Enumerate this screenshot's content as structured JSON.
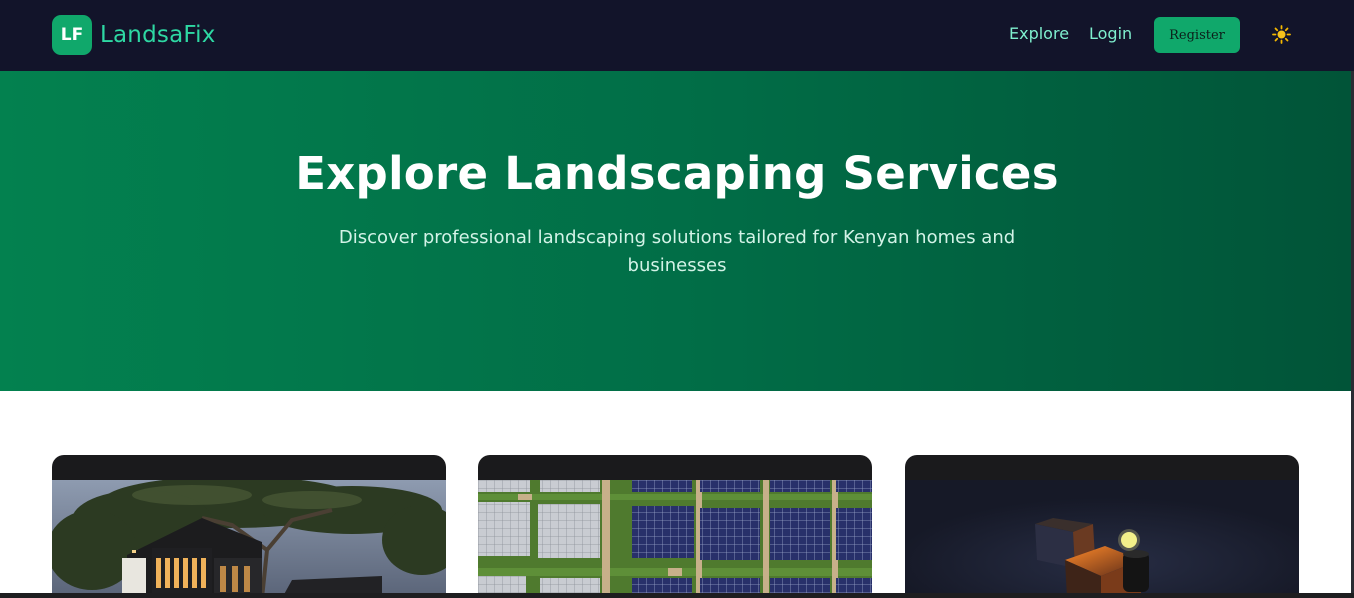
{
  "brand": {
    "logo_text": "LF",
    "name": "LandsaFix"
  },
  "nav": {
    "explore_label": "Explore",
    "login_label": "Login",
    "register_label": "Register",
    "theme_icon": "sun-icon"
  },
  "hero": {
    "title": "Explore Landscaping Services",
    "subtitle": "Discover professional landscaping solutions tailored for Kenyan homes and businesses"
  },
  "cards": [
    {
      "image": "modern-house-with-tree-photo"
    },
    {
      "image": "solar-panels-garden-aerial-photo"
    },
    {
      "image": "abstract-3d-cubes-render"
    }
  ],
  "colors": {
    "navbar_bg": "#12142a",
    "accent": "#10a86b",
    "brand_text": "#2ed8a3",
    "hero_gradient_start": "#03814f",
    "hero_gradient_end": "#015438",
    "card_bg": "#1a1a1c"
  }
}
